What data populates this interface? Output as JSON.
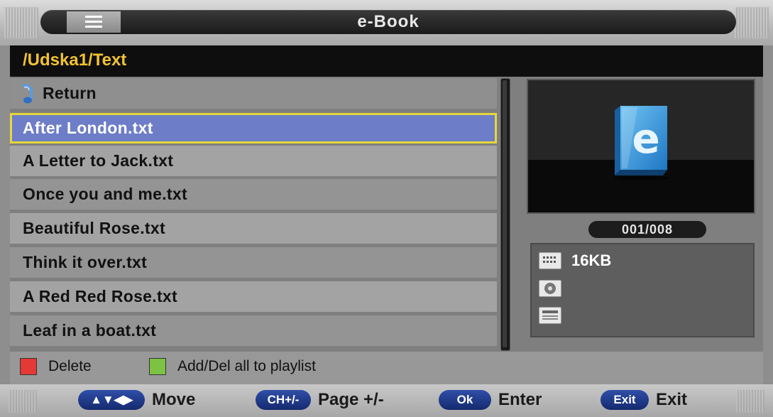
{
  "header": {
    "title": "e-Book",
    "menu_icon": "list-icon"
  },
  "path": "/Udska1/Text",
  "list": {
    "return_label": "Return",
    "return_icon": "music-note-icon",
    "selected_index": 0,
    "files": [
      "After London.txt",
      "A Letter to Jack.txt",
      "Once you and me.txt",
      "Beautiful Rose.txt",
      "Think it over.txt",
      "A Red Red Rose.txt",
      "Leaf in a boat.txt"
    ]
  },
  "preview": {
    "icon": "ebook-icon",
    "counter": "001/008"
  },
  "info": {
    "size": "16KB",
    "size_icon": "size-icon",
    "disc_icon": "disc-icon",
    "date_icon": "calendar-icon"
  },
  "legend": [
    {
      "color": "#e53935",
      "label": "Delete"
    },
    {
      "color": "#7cc243",
      "label": "Add/Del all to playlist"
    }
  ],
  "footer": [
    {
      "key": "▲▼◀▶",
      "label": "Move"
    },
    {
      "key": "CH+/-",
      "label": "Page +/-"
    },
    {
      "key": "Ok",
      "label": "Enter"
    },
    {
      "key": "Exit",
      "label": "Exit"
    }
  ],
  "colors": {
    "path_text": "#f1c232",
    "selection_fill": "#6d7dc7",
    "selection_border": "#e4d73a",
    "keycap": "#1f3a8a"
  }
}
